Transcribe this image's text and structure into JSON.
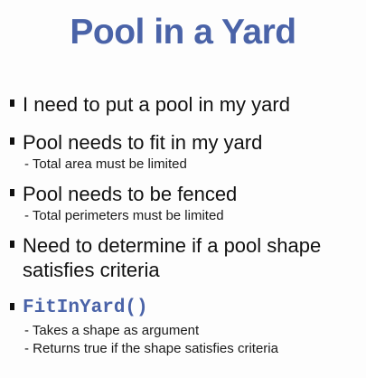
{
  "slide": {
    "title": "Pool in a Yard",
    "bullets": [
      {
        "text": "I need to put a pool in my yard"
      },
      {
        "text": "Pool needs to fit in my yard",
        "sub": [
          "- Total area must be limited"
        ]
      },
      {
        "text": "Pool needs to be fenced",
        "sub": [
          "- Total perimeters must be limited"
        ]
      },
      {
        "text": "Need to determine if a pool shape satisfies criteria"
      },
      {
        "text": "FitInYard()",
        "sub": [
          "- Takes a shape as argument",
          "- Returns true if the shape satisfies criteria"
        ]
      }
    ]
  },
  "colors": {
    "title": "#4a63a8",
    "code": "#4a63a8",
    "text": "#111111"
  }
}
